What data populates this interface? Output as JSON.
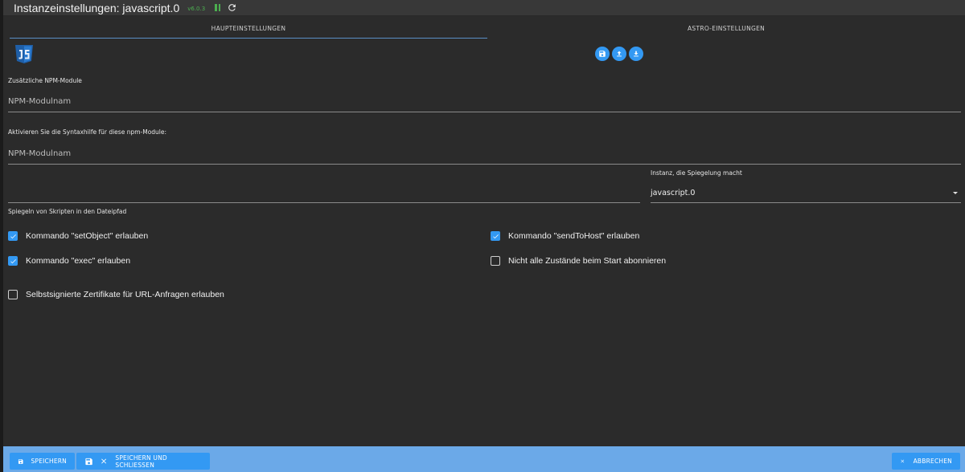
{
  "window": {
    "title": "Instanzeinstellungen: javascript.0",
    "version": "v6.0.3"
  },
  "tabs": [
    {
      "label": "HAUPTEINSTELLUNGEN",
      "active": true
    },
    {
      "label": "ASTRO-EINSTELLUNGEN",
      "active": false
    }
  ],
  "icons": {
    "logo": "js-logo-icon",
    "save_file": "save-icon",
    "upload": "upload-icon",
    "download": "download-icon"
  },
  "npm_modules": {
    "label": "Zusätzliche NPM-Module",
    "placeholder": "NPM-Modulnam"
  },
  "syntax_help": {
    "label": "Aktivieren Sie die Syntaxhilfe für diese npm-Module:",
    "placeholder": "NPM-Modulnam"
  },
  "mirror": {
    "path_label": "Spiegeln von Skripten in den Dateipfad",
    "path_value": "",
    "instance_label": "Instanz, die Spiegelung macht",
    "instance_value": "javascript.0"
  },
  "checkboxes": {
    "set_object": {
      "label": "Kommando \"setObject\" erlauben",
      "checked": true
    },
    "send_to_host": {
      "label": "Kommando \"sendToHost\" erlauben",
      "checked": true
    },
    "exec": {
      "label": "Kommando \"exec\" erlauben",
      "checked": true
    },
    "no_subscribe": {
      "label": "Nicht alle Zustände beim Start abonnieren",
      "checked": false
    },
    "self_signed": {
      "label": "Selbstsignierte Zertifikate für URL-Anfragen erlauben",
      "checked": false
    }
  },
  "footer": {
    "save": "SPEICHERN",
    "save_close": "SPEICHERN UND SCHLIESSEN",
    "cancel": "ABBRECHEN"
  },
  "colors": {
    "accent": "#3399f3",
    "footer": "#6ba9e8",
    "status_green": "#4caf50",
    "background": "#2b2b2b"
  }
}
